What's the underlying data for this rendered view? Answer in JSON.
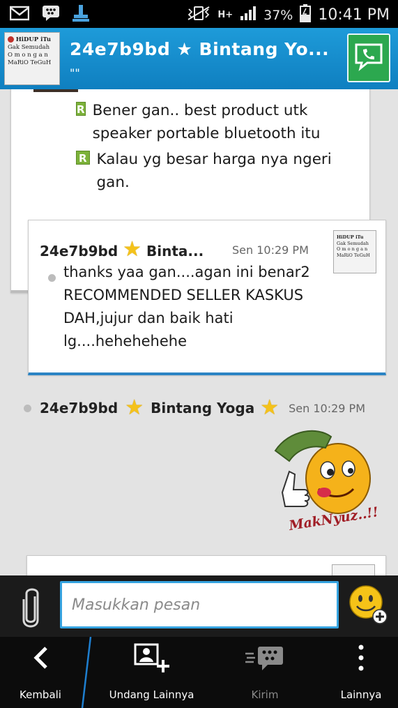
{
  "status_bar": {
    "battery": "37%",
    "time": "10:41 PM",
    "network": "H+"
  },
  "header": {
    "contact_name": "24e7b9bd ★ Bintang Yo...",
    "contact_status": "\"\"",
    "avatar_text": [
      "HiDUP iTu",
      "Gak Semudah",
      "O m o n g a n",
      "MaRiO TeGuH"
    ]
  },
  "messages": {
    "first": {
      "lines": [
        "Bener gan.. best product utk speaker portable bluetooth itu",
        "Kalau yg besar harga nya ngeri gan."
      ],
      "icon_letter": "R"
    },
    "second": {
      "sender": "24e7b9bd",
      "sender_suffix": "Binta...",
      "time": "Sen 10:29 PM",
      "text": "thanks yaa gan....agan ini benar2 RECOMMENDED SELLER KASKUS DAH,jujur dan baik hati lg....hehehehehe"
    },
    "sticker": {
      "sender": "24e7b9bd",
      "sender_name": "Bintang Yoga",
      "time": "Sen 10:29 PM",
      "caption": "MakNyuz..!!"
    }
  },
  "input": {
    "placeholder": "Masukkan pesan"
  },
  "bottom_nav": {
    "back": "Kembali",
    "invite": "Undang Lainnya",
    "send": "Kirim",
    "more": "Lainnya"
  },
  "colors": {
    "header_blue": "#1e9bd9",
    "call_green": "#2ca84f",
    "input_border": "#36a3e0",
    "bubble_accent": "#2b84c4"
  }
}
